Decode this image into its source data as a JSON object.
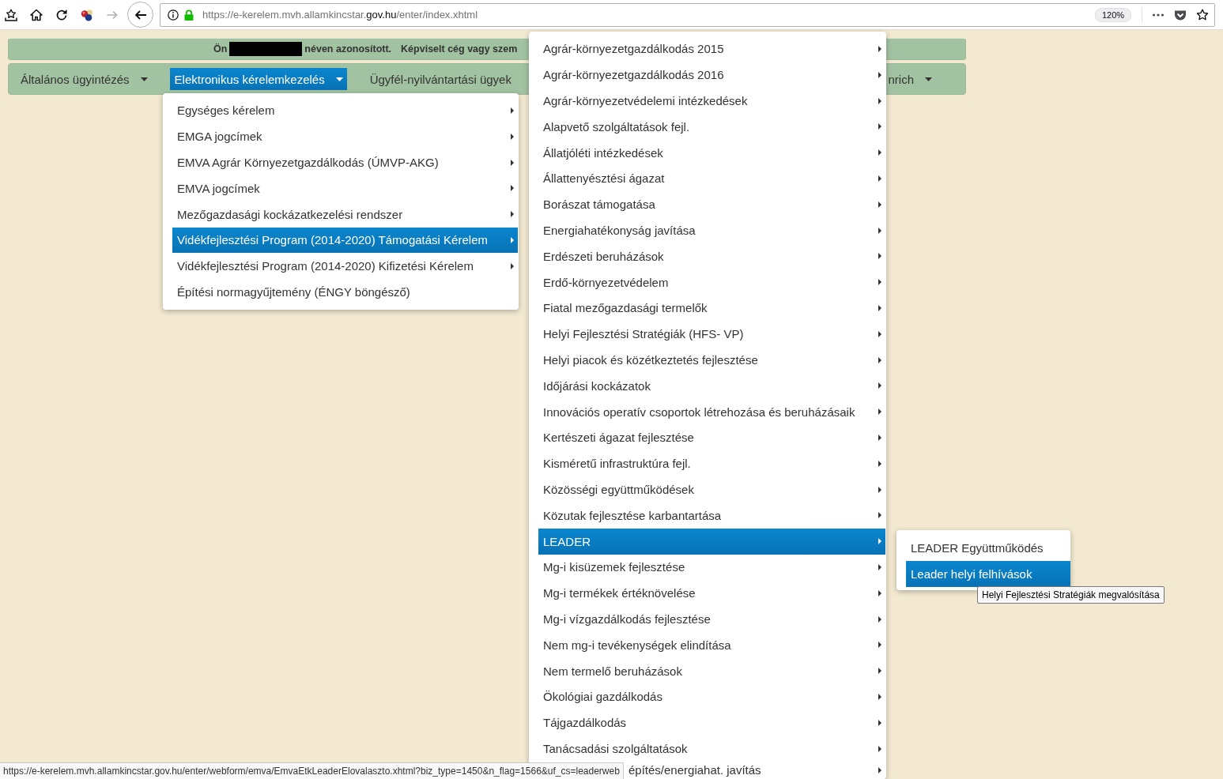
{
  "browser": {
    "forward_disabled": true,
    "url": {
      "start": "https://e-kerelem.mvh.allamkincstar.",
      "domain": "gov.hu",
      "end": "/enter/index.xhtml"
    },
    "zoom": "120%"
  },
  "identity_bar": {
    "prefix": "Ön",
    "suffix": "néven azonosított.",
    "represented": "Képviselt cég vagy szem"
  },
  "nav": [
    {
      "label": "Általános ügyintézés",
      "selected": false,
      "dropdown": true
    },
    {
      "label": "Elektronikus kérelemkezelés",
      "selected": true,
      "dropdown": true
    },
    {
      "label": "Ügyfél-nyilvántartási ügyek",
      "selected": false,
      "dropdown": false
    },
    {
      "label": "nrich",
      "selected": false,
      "dropdown": true
    }
  ],
  "menu_level1": {
    "items": [
      {
        "label": "Egységes kérelem",
        "selected": false,
        "submenu": true
      },
      {
        "label": "EMGA jogcímek",
        "selected": false,
        "submenu": true
      },
      {
        "label": "EMVA Agrár Környezetgazdálkodás (ÚMVP-AKG)",
        "selected": false,
        "submenu": true
      },
      {
        "label": "EMVA jogcímek",
        "selected": false,
        "submenu": true
      },
      {
        "label": "Mezőgazdasági kockázatkezelési rendszer",
        "selected": false,
        "submenu": true
      },
      {
        "label": "Vidékfejlesztési Program (2014-2020) Támogatási Kérelem",
        "selected": true,
        "submenu": true
      },
      {
        "label": "Vidékfejlesztési Program (2014-2020) Kifizetési Kérelem",
        "selected": false,
        "submenu": true
      },
      {
        "label": "Építési normagyűjtemény (ÉNGY böngésző)",
        "selected": false,
        "submenu": false
      }
    ]
  },
  "menu_level2": {
    "items": [
      {
        "label": "Agrár-környezetgazdálkodás 2015",
        "selected": false,
        "submenu": true
      },
      {
        "label": "Agrár-környezetgazdálkodás 2016",
        "selected": false,
        "submenu": true
      },
      {
        "label": "Agrár-környezetvédelemi intézkedések",
        "selected": false,
        "submenu": true
      },
      {
        "label": "Alapvető szolgáltatások fejl.",
        "selected": false,
        "submenu": true
      },
      {
        "label": "Állatjóléti intézkedések",
        "selected": false,
        "submenu": true
      },
      {
        "label": "Állattenyésztési ágazat",
        "selected": false,
        "submenu": true
      },
      {
        "label": "Borászat támogatása",
        "selected": false,
        "submenu": true
      },
      {
        "label": "Energiahatékonyság javítása",
        "selected": false,
        "submenu": true
      },
      {
        "label": "Erdészeti beruházások",
        "selected": false,
        "submenu": true
      },
      {
        "label": "Erdő-környezetvédelem",
        "selected": false,
        "submenu": true
      },
      {
        "label": "Fiatal mezőgazdasági termelők",
        "selected": false,
        "submenu": true
      },
      {
        "label": "Helyi Fejlesztési Stratégiák (HFS- VP)",
        "selected": false,
        "submenu": true
      },
      {
        "label": "Helyi piacok és közétkeztetés fejlesztése",
        "selected": false,
        "submenu": true
      },
      {
        "label": "Időjárási kockázatok",
        "selected": false,
        "submenu": true
      },
      {
        "label": "Innovációs operatív csoportok létrehozása és beruházásaik",
        "selected": false,
        "submenu": true
      },
      {
        "label": "Kertészeti ágazat fejlesztése",
        "selected": false,
        "submenu": true
      },
      {
        "label": "Kisméretű infrastruktúra fejl.",
        "selected": false,
        "submenu": true
      },
      {
        "label": "Közösségi együttműködések",
        "selected": false,
        "submenu": true
      },
      {
        "label": "Közutak fejlesztése karbantartása",
        "selected": false,
        "submenu": true
      },
      {
        "label": "LEADER",
        "selected": true,
        "submenu": true
      },
      {
        "label": "Mg-i kisüzemek fejlesztése",
        "selected": false,
        "submenu": true
      },
      {
        "label": "Mg-i termékek értéknövelése",
        "selected": false,
        "submenu": true
      },
      {
        "label": "Mg-i vízgazdálkodás fejlesztése",
        "selected": false,
        "submenu": true
      },
      {
        "label": "Nem mg-i tevékenységek elindítása",
        "selected": false,
        "submenu": true
      },
      {
        "label": "Nem termelő beruházások",
        "selected": false,
        "submenu": true
      },
      {
        "label": "Ökológiai gazdálkodás",
        "selected": false,
        "submenu": true
      },
      {
        "label": "Tájgazdálkodás",
        "selected": false,
        "submenu": true
      },
      {
        "label": "Tanácsadási szolgáltatások",
        "selected": false,
        "submenu": true
      }
    ],
    "partial_item": {
      "label": "építés/energiahat. javítás",
      "submenu": true
    }
  },
  "menu_level3": {
    "items": [
      {
        "label": "LEADER Együttműködés",
        "selected": false,
        "submenu": false
      },
      {
        "label": "Leader helyi felhívások",
        "selected": true,
        "submenu": false
      }
    ]
  },
  "tooltip": "Helyi Fejlesztési Stratégiák megvalósítása",
  "status_link": "https://e-kerelem.mvh.allamkincstar.gov.hu/enter/webform/emva/EmvaEtkLeaderElovalaszto.xhtml?biz_type=1450&n_flag=1566&uf_cs=leaderweb"
}
